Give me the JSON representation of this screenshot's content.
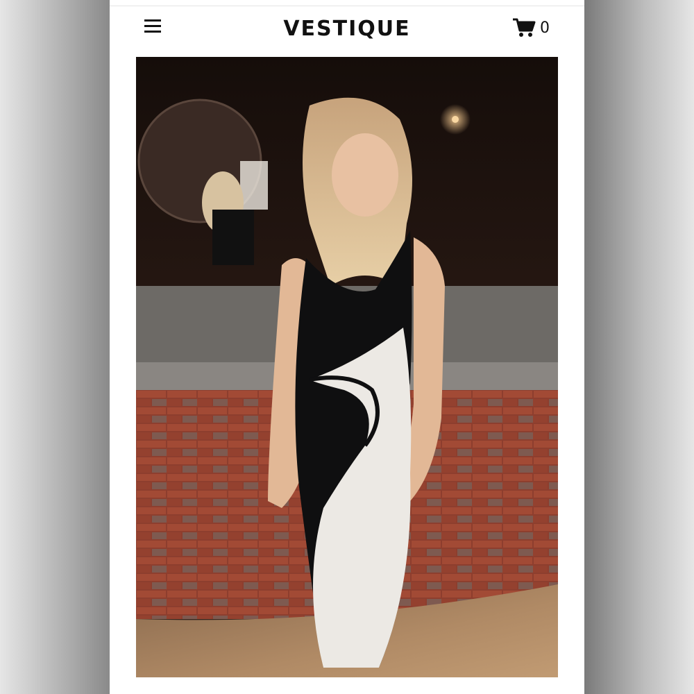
{
  "header": {
    "brand": "VESTIQUE",
    "cart_count": "0",
    "menu_icon": "hamburger-menu-icon",
    "cart_icon": "shopping-cart-icon"
  },
  "product": {
    "image_description_icon": "product-photo"
  },
  "colors": {
    "background": "#ffffff",
    "brand_text": "#111111",
    "icon": "#111111"
  }
}
